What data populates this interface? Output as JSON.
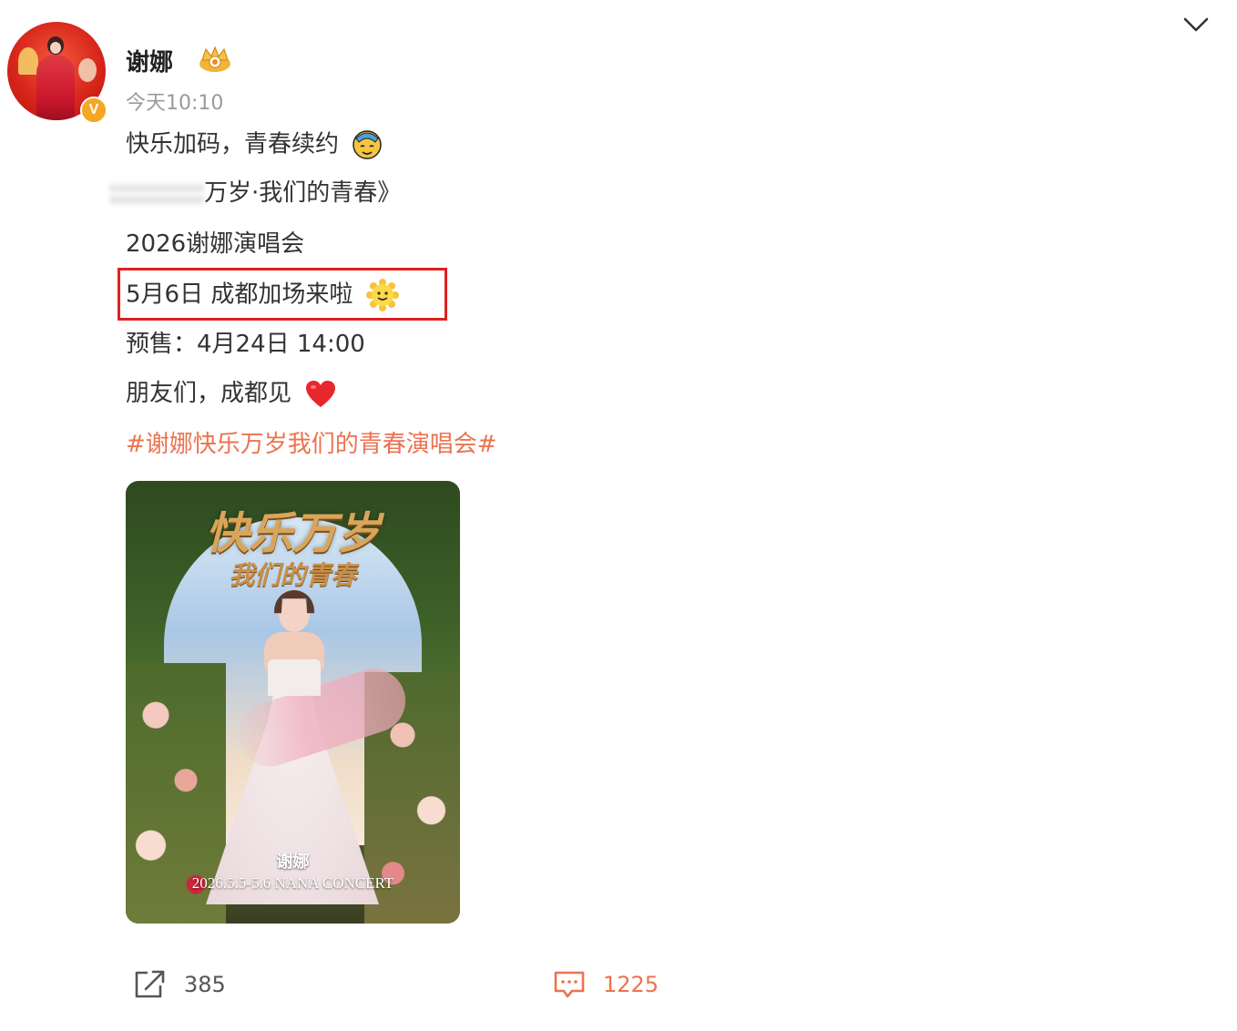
{
  "author": {
    "name": "谢娜",
    "timestamp": "今天10:10",
    "verified_badge": "V",
    "vip_icon": "crown-icon"
  },
  "post": {
    "line1": "快乐加码，青春续约",
    "line2_visible": "万岁·我们的青春》",
    "line3": "2026谢娜演唱会",
    "line4_highlight": "5月6日 成都加场来啦",
    "line5": "预售：4月24日 14:00",
    "line6": "朋友们，成都见",
    "hashtag": "#谢娜快乐万岁我们的青春演唱会#"
  },
  "poster": {
    "title_main": "快乐万岁",
    "title_sub": "我们的青春",
    "artist": "谢娜",
    "concert_line": "2026.5.5-5.6  NANA CONCERT"
  },
  "actions": {
    "repost_count": "385",
    "comment_count": "1225"
  },
  "colors": {
    "hashtag": "#eb7350",
    "highlight_border": "#e02020",
    "timestamp": "#9a9a9a",
    "verified": "#f5a623"
  }
}
